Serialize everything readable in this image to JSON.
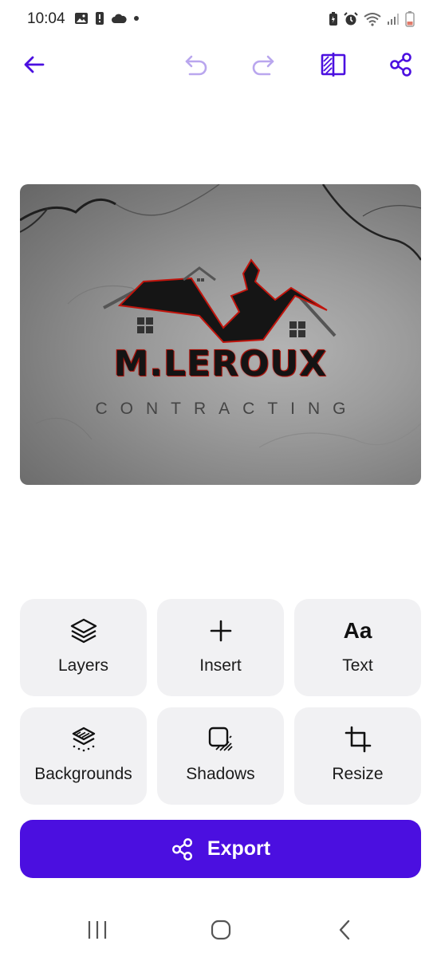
{
  "status": {
    "time": "10:04",
    "left_icons": [
      "image-icon",
      "alert-icon",
      "cloud-icon",
      "dot-icon"
    ],
    "right_icons": [
      "battery-saver-icon",
      "alarm-icon",
      "wifi-icon",
      "signal-icon",
      "battery-icon"
    ]
  },
  "toolbar": {
    "back_icon": "arrow-left-icon",
    "undo_icon": "undo-icon",
    "redo_icon": "redo-icon",
    "compare_icon": "compare-icon",
    "share_icon": "share-icon",
    "accent": "#4b0fe0",
    "disabled": "#b9a6ee"
  },
  "canvas": {
    "brand_name": "M.LEROUX",
    "brand_tagline": "CONTRACTING"
  },
  "tools": [
    {
      "label": "Layers",
      "icon": "layers-icon"
    },
    {
      "label": "Insert",
      "icon": "plus-icon"
    },
    {
      "label": "Text",
      "icon_text": "Aa"
    },
    {
      "label": "Backgrounds",
      "icon": "backgrounds-icon"
    },
    {
      "label": "Shadows",
      "icon": "shadows-icon"
    },
    {
      "label": "Resize",
      "icon": "crop-icon"
    }
  ],
  "export": {
    "label": "Export",
    "icon": "share-icon",
    "color": "#4b0fe0"
  },
  "navbar": {
    "recents_icon": "recents-icon",
    "home_icon": "home-icon",
    "back_icon": "back-chevron-icon"
  }
}
